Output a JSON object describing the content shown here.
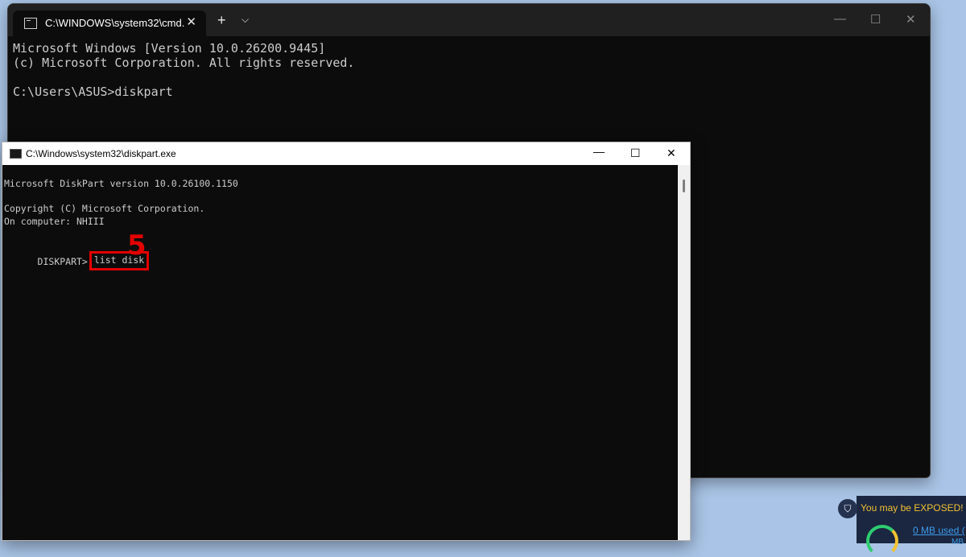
{
  "terminal": {
    "tab_title": "C:\\WINDOWS\\system32\\cmd.",
    "tab_close": "✕",
    "new_tab": "+",
    "dropdown": "⌵",
    "controls": {
      "minimize": "—",
      "maximize": "☐",
      "close": "✕"
    },
    "lines": [
      "Microsoft Windows [Version 10.0.26200.9445]",
      "(c) Microsoft Corporation. All rights reserved.",
      "",
      "C:\\Users\\ASUS>diskpart"
    ]
  },
  "diskpart": {
    "title": "C:\\Windows\\system32\\diskpart.exe",
    "controls": {
      "minimize": "—",
      "maximize": "☐",
      "close": "✕"
    },
    "lines": [
      "Microsoft DiskPart version 10.0.26100.1150",
      "",
      "Copyright (C) Microsoft Corporation.",
      "On computer: NHIII",
      ""
    ],
    "prompt": "DISKPART>",
    "command": "list disk",
    "step_number": "5"
  },
  "vpn_widget": {
    "warning": "You may be EXPOSED!",
    "usage": "0 MB used (",
    "unit": "MB",
    "shield_icon": "shield-icon",
    "accent": "#f1c232"
  }
}
